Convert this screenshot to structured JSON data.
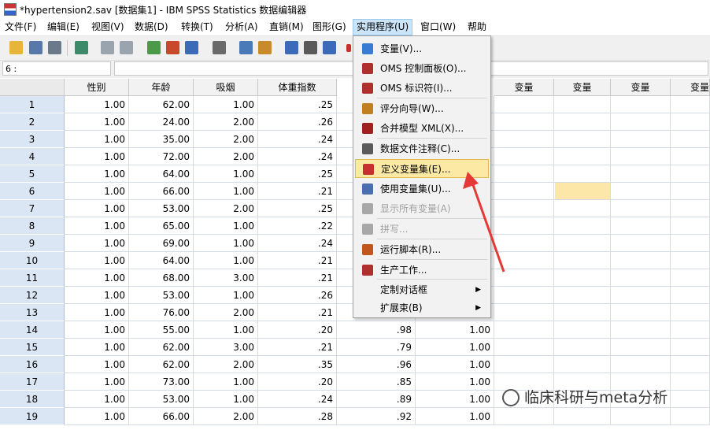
{
  "window": {
    "title": "*hypertension2.sav [数据集1] - IBM SPSS Statistics 数据编辑器"
  },
  "menubar": [
    "文件(F)",
    "编辑(E)",
    "视图(V)",
    "数据(D)",
    "转换(T)",
    "分析(A)",
    "直销(M)",
    "图形(G)",
    "实用程序(U)",
    "窗口(W)",
    "帮助"
  ],
  "cellbar": {
    "ref": "6 :",
    "value": ""
  },
  "columns": [
    "性别",
    "年龄",
    "吸烟",
    "体重指数",
    "变量",
    "变量",
    "变量",
    "变量",
    "变量"
  ],
  "rows": [
    {
      "n": "1",
      "c": [
        "1.00",
        "62.00",
        "1.00",
        ".25"
      ]
    },
    {
      "n": "2",
      "c": [
        "1.00",
        "24.00",
        "2.00",
        ".26"
      ]
    },
    {
      "n": "3",
      "c": [
        "1.00",
        "35.00",
        "2.00",
        ".24"
      ]
    },
    {
      "n": "4",
      "c": [
        "1.00",
        "72.00",
        "2.00",
        ".24"
      ]
    },
    {
      "n": "5",
      "c": [
        "1.00",
        "64.00",
        "1.00",
        ".25"
      ]
    },
    {
      "n": "6",
      "c": [
        "1.00",
        "66.00",
        "1.00",
        ".21"
      ]
    },
    {
      "n": "7",
      "c": [
        "1.00",
        "53.00",
        "2.00",
        ".25"
      ]
    },
    {
      "n": "8",
      "c": [
        "1.00",
        "65.00",
        "1.00",
        ".22"
      ]
    },
    {
      "n": "9",
      "c": [
        "1.00",
        "69.00",
        "1.00",
        ".24"
      ]
    },
    {
      "n": "10",
      "c": [
        "1.00",
        "64.00",
        "1.00",
        ".21"
      ]
    },
    {
      "n": "11",
      "c": [
        "1.00",
        "68.00",
        "3.00",
        ".21"
      ]
    },
    {
      "n": "12",
      "c": [
        "1.00",
        "53.00",
        "1.00",
        ".26"
      ]
    },
    {
      "n": "13",
      "c": [
        "1.00",
        "76.00",
        "2.00",
        ".21"
      ]
    },
    {
      "n": "14",
      "c": [
        "1.00",
        "55.00",
        "1.00",
        ".20",
        ".98",
        "1.00"
      ]
    },
    {
      "n": "15",
      "c": [
        "1.00",
        "62.00",
        "3.00",
        ".21",
        ".79",
        "1.00"
      ]
    },
    {
      "n": "16",
      "c": [
        "1.00",
        "62.00",
        "2.00",
        ".35",
        ".96",
        "1.00"
      ]
    },
    {
      "n": "17",
      "c": [
        "1.00",
        "73.00",
        "1.00",
        ".20",
        ".85",
        "1.00"
      ]
    },
    {
      "n": "18",
      "c": [
        "1.00",
        "53.00",
        "1.00",
        ".24",
        ".89",
        "1.00"
      ]
    },
    {
      "n": "19",
      "c": [
        "1.00",
        "66.00",
        "2.00",
        ".28",
        ".92",
        "1.00"
      ]
    }
  ],
  "menu": {
    "items": [
      {
        "label": "变量(V)...",
        "icon": "variables-icon",
        "color": "#3a7bd5"
      },
      {
        "label": "OMS 控制面板(O)...",
        "icon": "oms-control-icon",
        "color": "#b03030"
      },
      {
        "label": "OMS 标识符(I)...",
        "icon": "oms-identifier-icon",
        "color": "#b03030"
      },
      {
        "label": "评分向导(W)...",
        "icon": "scoring-wizard-icon",
        "color": "#c08020"
      },
      {
        "label": "合并模型 XML(X)...",
        "icon": "merge-model-icon",
        "color": "#a02020"
      },
      {
        "label": "数据文件注释(C)...",
        "icon": "data-comments-icon",
        "color": "#5a5a5a"
      },
      {
        "label": "定义变量集(E)...",
        "icon": "define-sets-icon",
        "color": "#c83030"
      },
      {
        "label": "使用变量集(U)...",
        "icon": "use-sets-icon",
        "color": "#4a6fb0"
      },
      {
        "label": "显示所有变量(A)",
        "icon": "show-all-icon",
        "color": "#a8a8a8"
      },
      {
        "label": "拼写...",
        "icon": "spelling-icon",
        "color": "#a8a8a8"
      },
      {
        "label": "运行脚本(R)...",
        "icon": "run-script-icon",
        "color": "#c0561e"
      },
      {
        "label": "生产工作...",
        "icon": "production-job-icon",
        "color": "#b03030"
      },
      {
        "label": "定制对话框",
        "icon": "",
        "color": ""
      },
      {
        "label": "扩展束(B)",
        "icon": "",
        "color": ""
      }
    ]
  },
  "watermark": {
    "text": "临床科研与meta分析"
  }
}
